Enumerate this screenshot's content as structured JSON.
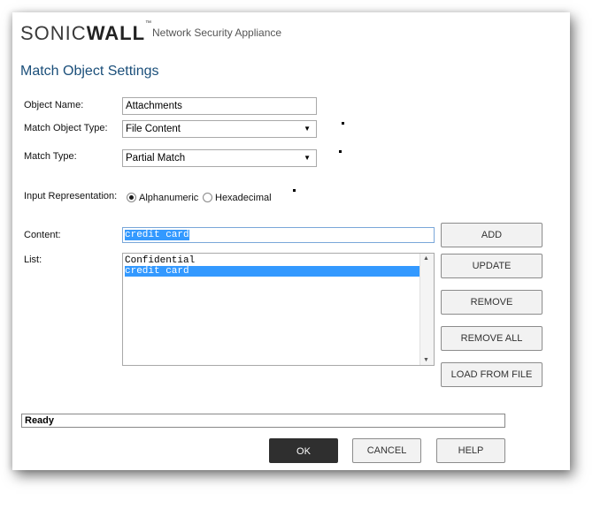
{
  "header": {
    "logo_left": "SONIC",
    "logo_right": "WALL",
    "logo_tm": "™",
    "tagline": "Network Security Appliance"
  },
  "page_title": "Match Object Settings",
  "form": {
    "object_name_label": "Object Name:",
    "object_name_value": "Attachments",
    "match_object_type_label": "Match Object Type:",
    "match_object_type_value": "File Content",
    "match_type_label": "Match Type:",
    "match_type_value": "Partial Match",
    "input_rep_label": "Input Representation:",
    "input_rep_options": [
      "Alphanumeric",
      "Hexadecimal"
    ],
    "input_rep_selected": "Alphanumeric",
    "content_label": "Content:",
    "content_value": "credit card",
    "list_label": "List:",
    "list_items": [
      "Confidential",
      "credit card"
    ],
    "list_selected": "credit card"
  },
  "buttons": {
    "add": "ADD",
    "update": "UPDATE",
    "remove": "REMOVE",
    "remove_all": "REMOVE ALL",
    "load_from_file": "LOAD FROM FILE",
    "ok": "OK",
    "cancel": "CANCEL",
    "help": "HELP"
  },
  "status": "Ready",
  "colors": {
    "title": "#1b4f7a",
    "selection": "#3399ff",
    "ok_button": "#2f2f2f"
  }
}
